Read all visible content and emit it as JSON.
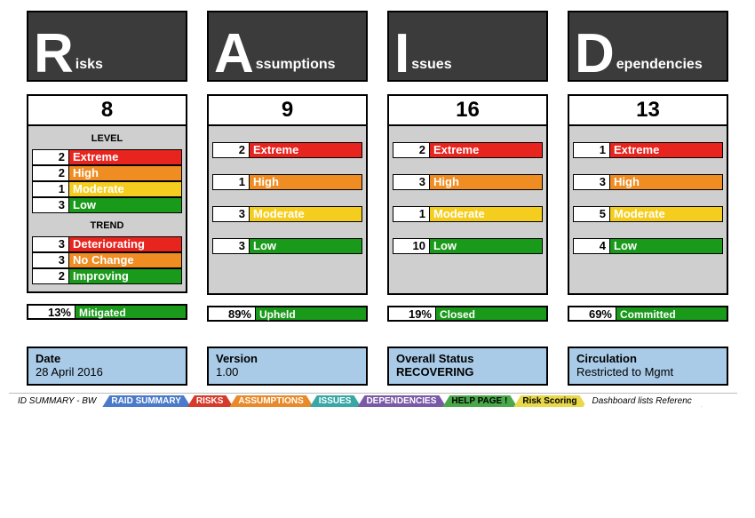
{
  "headers": {
    "risks": {
      "big": "R",
      "rest": "isks"
    },
    "assumptions": {
      "big": "A",
      "rest": "ssumptions"
    },
    "issues": {
      "big": "I",
      "rest": "ssues"
    },
    "dependencies": {
      "big": "D",
      "rest": "ependencies"
    }
  },
  "counts": {
    "risks": "8",
    "assumptions": "9",
    "issues": "16",
    "dependencies": "13"
  },
  "labels": {
    "level": "LEVEL",
    "trend": "TREND"
  },
  "colors": {
    "extreme": "#e8241f",
    "high": "#ef8c22",
    "moderate": "#f4cd1f",
    "low": "#1a9a1a",
    "deteriorating": "#e8241f",
    "nochange": "#ef8c22",
    "improving": "#1a9a1a",
    "status_ok": "#1a9a1a"
  },
  "risks": {
    "level": [
      {
        "n": "2",
        "label": "Extreme"
      },
      {
        "n": "2",
        "label": "High"
      },
      {
        "n": "1",
        "label": "Moderate"
      },
      {
        "n": "3",
        "label": "Low"
      }
    ],
    "trend": [
      {
        "n": "3",
        "label": "Deteriorating"
      },
      {
        "n": "3",
        "label": "No Change"
      },
      {
        "n": "2",
        "label": "Improving"
      }
    ],
    "status": {
      "pct": "13%",
      "label": "Mitigated"
    }
  },
  "assumptions": {
    "level": [
      {
        "n": "2",
        "label": "Extreme"
      },
      {
        "n": "1",
        "label": "High"
      },
      {
        "n": "3",
        "label": "Moderate"
      },
      {
        "n": "3",
        "label": "Low"
      }
    ],
    "status": {
      "pct": "89%",
      "label": "Upheld"
    }
  },
  "issues": {
    "level": [
      {
        "n": "2",
        "label": "Extreme"
      },
      {
        "n": "3",
        "label": "High"
      },
      {
        "n": "1",
        "label": "Moderate"
      },
      {
        "n": "10",
        "label": "Low"
      }
    ],
    "status": {
      "pct": "19%",
      "label": "Closed"
    }
  },
  "dependencies": {
    "level": [
      {
        "n": "1",
        "label": "Extreme"
      },
      {
        "n": "3",
        "label": "High"
      },
      {
        "n": "5",
        "label": "Moderate"
      },
      {
        "n": "4",
        "label": "Low"
      }
    ],
    "status": {
      "pct": "69%",
      "label": "Committed"
    }
  },
  "info": {
    "date": {
      "label": "Date",
      "value": "28 April 2016"
    },
    "version": {
      "label": "Version",
      "value": "1.00"
    },
    "overall": {
      "label": "Overall Status",
      "value": "RECOVERING"
    },
    "circ": {
      "label": "Circulation",
      "value": "Restricted to Mgmt"
    }
  },
  "tabs": {
    "t0": "ID SUMMARY - BW",
    "t1": "RAID SUMMARY",
    "t2": "RISKS",
    "t3": "ASSUMPTIONS",
    "t4": "ISSUES",
    "t5": "DEPENDENCIES",
    "t6": "HELP PAGE !",
    "t7": "Risk Scoring",
    "t8": "Dashboard lists Referenc"
  },
  "chart_data": [
    {
      "type": "table",
      "title": "Risks - Level",
      "categories": [
        "Extreme",
        "High",
        "Moderate",
        "Low"
      ],
      "values": [
        2,
        2,
        1,
        3
      ]
    },
    {
      "type": "table",
      "title": "Risks - Trend",
      "categories": [
        "Deteriorating",
        "No Change",
        "Improving"
      ],
      "values": [
        3,
        3,
        2
      ]
    },
    {
      "type": "table",
      "title": "Assumptions - Level",
      "categories": [
        "Extreme",
        "High",
        "Moderate",
        "Low"
      ],
      "values": [
        2,
        1,
        3,
        3
      ]
    },
    {
      "type": "table",
      "title": "Issues - Level",
      "categories": [
        "Extreme",
        "High",
        "Moderate",
        "Low"
      ],
      "values": [
        2,
        3,
        1,
        10
      ]
    },
    {
      "type": "table",
      "title": "Dependencies - Level",
      "categories": [
        "Extreme",
        "High",
        "Moderate",
        "Low"
      ],
      "values": [
        1,
        3,
        5,
        4
      ]
    },
    {
      "type": "table",
      "title": "Counts",
      "categories": [
        "Risks",
        "Assumptions",
        "Issues",
        "Dependencies"
      ],
      "values": [
        8,
        9,
        16,
        13
      ]
    },
    {
      "type": "table",
      "title": "Status %",
      "categories": [
        "Mitigated",
        "Upheld",
        "Closed",
        "Committed"
      ],
      "values": [
        13,
        89,
        19,
        69
      ]
    }
  ]
}
